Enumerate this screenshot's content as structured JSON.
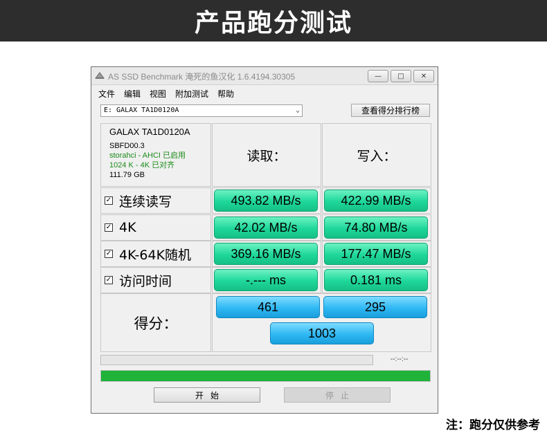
{
  "banner": {
    "title": "产品跑分测试"
  },
  "window": {
    "title": "AS SSD Benchmark 淹死的鱼汉化 1.6.4194.30305",
    "buttons": {
      "minimize": "—",
      "maximize": "□",
      "close": "✕"
    }
  },
  "menu": [
    "文件",
    "编辑",
    "视图",
    "附加测试",
    "帮助"
  ],
  "drive": {
    "selected": "E: GALAX TA1D0120A",
    "rank_button": "查看得分排行榜"
  },
  "info": {
    "model": "GALAX TA1D0120A",
    "firmware": "SBFD00.3",
    "driver": "storahci - AHCI 已启用",
    "alignment": "1024 K - 4K 已对齐",
    "capacity": "111.79 GB"
  },
  "headers": {
    "read": "读取：",
    "write": "写入："
  },
  "rows": [
    {
      "label": "连续读写",
      "read": "493.82 MB/s",
      "write": "422.99 MB/s"
    },
    {
      "label": "4K",
      "read": "42.02 MB/s",
      "write": "74.80 MB/s"
    },
    {
      "label": "4K-64K随机",
      "read": "369.16 MB/s",
      "write": "177.47 MB/s"
    },
    {
      "label": "访问时间",
      "read": "-.--- ms",
      "write": "0.181 ms"
    }
  ],
  "score": {
    "label": "得分：",
    "read": "461",
    "write": "295",
    "total": "1003"
  },
  "progress": {
    "time": "--:--:--",
    "overall_fraction": 1.0
  },
  "buttons": {
    "start": "开始",
    "stop": "停止"
  },
  "footnote": "注：跑分仅供参考",
  "colors": {
    "pill_green": "#1ed79a",
    "pill_blue": "#2fb8f3",
    "progress_green": "#1fb33a",
    "banner_bg": "#2d2d2d"
  }
}
